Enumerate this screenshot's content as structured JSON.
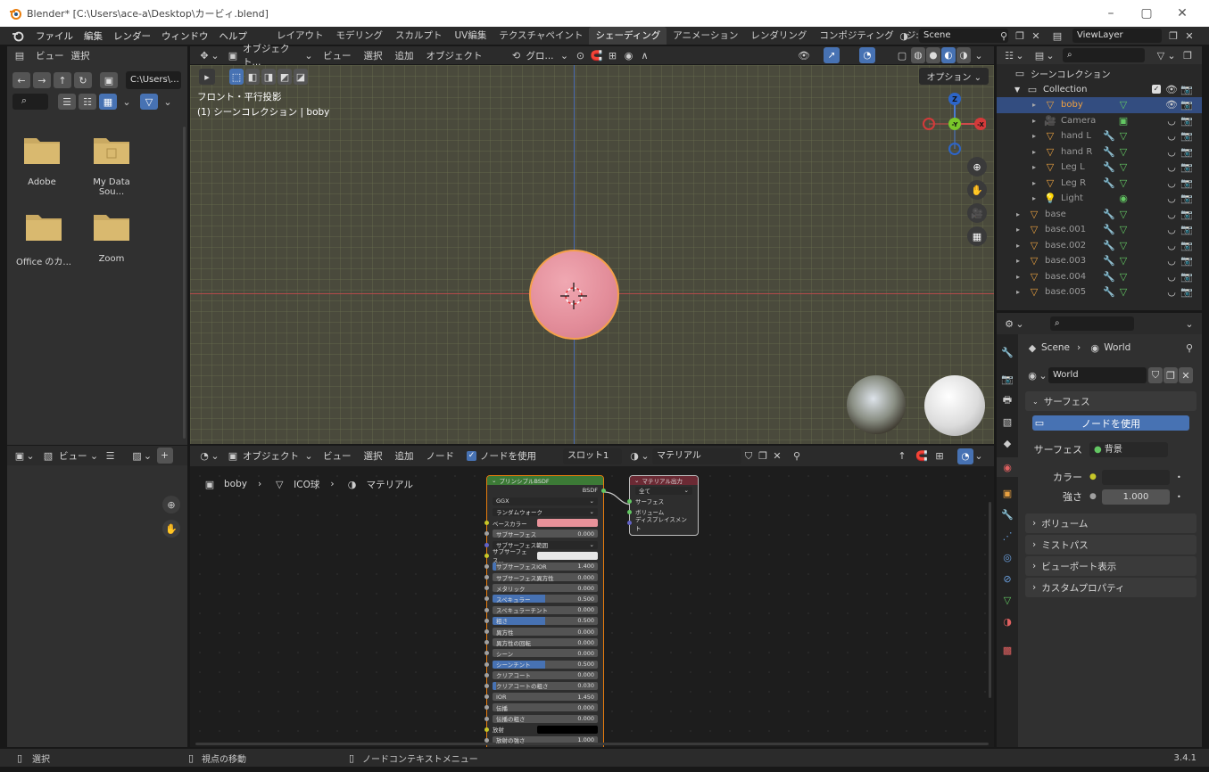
{
  "window": {
    "title": "Blender* [C:\\Users\\ace-a\\Desktop\\カービィ.blend]",
    "controls": [
      "–",
      "▢",
      "✕"
    ]
  },
  "menu": [
    "ファイル",
    "編集",
    "レンダー",
    "ウィンドウ",
    "ヘルプ"
  ],
  "workspaces": [
    "レイアウト",
    "モデリング",
    "スカルプト",
    "UV編集",
    "テクスチャペイント",
    "シェーディング",
    "アニメーション",
    "レンダリング",
    "コンポジティング",
    "ジ:"
  ],
  "active_workspace": "シェーディング",
  "scene_name": "Scene",
  "view_layer": "ViewLayer",
  "file_browser": {
    "menu": [
      "ビュー",
      "選択"
    ],
    "path": "C:\\Users\\...",
    "items": [
      "Adobe",
      "My Data Sou...",
      "Office のカ...",
      "Zoom"
    ]
  },
  "viewport": {
    "header": {
      "mode": "オブジェクト...",
      "menus": [
        "ビュー",
        "選択",
        "追加",
        "オブジェクト"
      ],
      "transform": "グロ...",
      "options": "オプション"
    },
    "overlay_title": "フロント・平行投影",
    "overlay_subtitle": "(1) シーンコレクション | boby",
    "gizmo": {
      "z": "Z",
      "y": "-Y",
      "x": "-X"
    }
  },
  "image_editor": {
    "menu": "ビュー"
  },
  "node_editor": {
    "header": {
      "mode": "オブジェクト",
      "menus": [
        "ビュー",
        "選択",
        "追加",
        "ノード"
      ],
      "use_nodes": "ノードを使用",
      "slot": "スロット1",
      "material": "マテリアル"
    },
    "breadcrumb": [
      "boby",
      "ICO球",
      "マテリアル"
    ],
    "bsdf_node": {
      "title": "プリンシプルBSDF",
      "output": "BSDF",
      "dist": "GGX",
      "sss_method": "ランダムウォーク",
      "base_color_label": "ベースカラー",
      "base_color": "#e8929a",
      "rows": [
        {
          "label": "サブサーフェス",
          "value": "0.000",
          "fill": 0
        },
        {
          "label": "サブサーフェス範囲",
          "value": "",
          "fill": 0,
          "dropdown": true
        },
        {
          "label": "サブサーフェス...",
          "value": "",
          "fill": 0,
          "color": "#e8e8e8"
        },
        {
          "label": "サブサーフェスIOR",
          "value": "1.400",
          "fill": 0.03
        },
        {
          "label": "サブサーフェス異方性",
          "value": "0.000",
          "fill": 0
        },
        {
          "label": "メタリック",
          "value": "0.000",
          "fill": 0
        },
        {
          "label": "スペキュラー",
          "value": "0.500",
          "fill": 0.5
        },
        {
          "label": "スペキュラーチント",
          "value": "0.000",
          "fill": 0
        },
        {
          "label": "粗さ",
          "value": "0.500",
          "fill": 0.5
        },
        {
          "label": "異方性",
          "value": "0.000",
          "fill": 0
        },
        {
          "label": "異方性の回転",
          "value": "0.000",
          "fill": 0
        },
        {
          "label": "シーン",
          "value": "0.000",
          "fill": 0
        },
        {
          "label": "シーンチント",
          "value": "0.500",
          "fill": 0.5
        },
        {
          "label": "クリアコート",
          "value": "0.000",
          "fill": 0
        },
        {
          "label": "クリアコートの粗さ",
          "value": "0.030",
          "fill": 0.03
        },
        {
          "label": "IOR",
          "value": "1.450",
          "fill": 0
        },
        {
          "label": "伝播",
          "value": "0.000",
          "fill": 0
        },
        {
          "label": "伝播の粗さ",
          "value": "0.000",
          "fill": 0
        },
        {
          "label": "放射",
          "value": "",
          "fill": 0,
          "color": "#000000"
        },
        {
          "label": "放射の強さ",
          "value": "1.000",
          "fill": 0
        }
      ]
    },
    "output_node": {
      "title": "マテリアル出力",
      "target": "全て",
      "inputs": [
        "サーフェス",
        "ボリューム",
        "ディスプレイスメント"
      ]
    }
  },
  "outliner": {
    "root": "シーンコレクション",
    "collection": "Collection",
    "children": [
      "boby",
      "Camera",
      "hand L",
      "hand R",
      "Leg L",
      "Leg R",
      "Light"
    ],
    "bases": [
      "base",
      "base.001",
      "base.002",
      "base.003",
      "base.004",
      "base.005"
    ],
    "selected": "boby"
  },
  "properties": {
    "breadcrumb": [
      "Scene",
      "World"
    ],
    "world_name": "World",
    "surface_label": "サーフェス",
    "use_nodes_btn": "ノードを使用",
    "surface_field_label": "サーフェス",
    "surface_value": "背景",
    "color_label": "カラー",
    "strength_label": "強さ",
    "strength_value": "1.000",
    "sections": [
      "ボリューム",
      "ミストパス",
      "ビューポート表示",
      "カスタムプロパティ"
    ]
  },
  "status_bar": {
    "select": "選択",
    "move": "視点の移動",
    "context": "ノードコンテキストメニュー",
    "version": "3.4.1"
  }
}
